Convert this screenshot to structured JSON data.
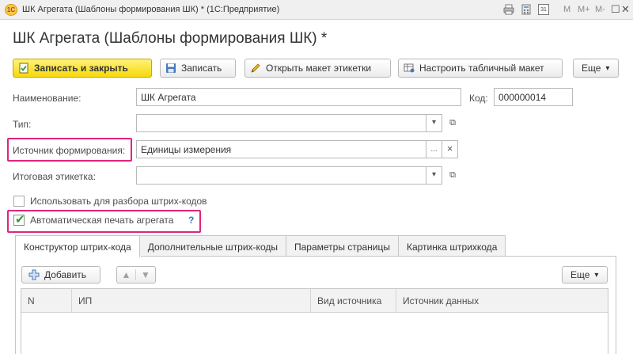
{
  "window": {
    "app_logo": "1С",
    "title": "ШК Агрегата (Шаблоны формирования ШК) * (1С:Предприятие)",
    "controls": {
      "memory_m": "M",
      "memory_m_plus": "M+",
      "memory_m_minus": "M-",
      "restore_glyph": "☐",
      "close_glyph": "✕",
      "calendar_day": "31"
    }
  },
  "page_title": "ШК Агрегата (Шаблоны формирования ШК) *",
  "toolbar": {
    "save_close_label": "Записать и закрыть",
    "save_label": "Записать",
    "open_layout_label": "Открыть макет этикетки",
    "configure_layout_label": "Настроить табличный макет",
    "more_label": "Еще",
    "more_arrow": "▾"
  },
  "form": {
    "name_label": "Наименование:",
    "name_value": "ШК Агрегата",
    "code_label": "Код:",
    "code_value": "000000014",
    "type_label": "Тип:",
    "type_value": "",
    "source_label": "Источник формирования:",
    "source_value": "Единицы измерения",
    "final_label_label": "Итоговая этикетка:",
    "final_label_value": "",
    "use_for_parsing_label": "Использовать для разбора штрих-кодов",
    "use_for_parsing_checked": false,
    "auto_print_label": "Автоматическая печать агрегата",
    "auto_print_checked": true,
    "help_glyph": "?",
    "dropdown_glyph": "▾",
    "open_glyph": "⧉",
    "select_glyph": "...",
    "clear_glyph": "×"
  },
  "tabs": [
    {
      "label": "Конструктор штрих-кода",
      "active": true
    },
    {
      "label": "Дополнительные штрих-коды",
      "active": false
    },
    {
      "label": "Параметры страницы",
      "active": false
    },
    {
      "label": "Картинка штрихкода",
      "active": false
    }
  ],
  "table_toolbar": {
    "add_label": "Добавить",
    "up_glyph": "🡅",
    "down_glyph": "🡇",
    "more_label": "Еще",
    "more_arrow": "▾"
  },
  "table": {
    "columns": [
      "N",
      "ИП",
      "Вид источника",
      "Источник данных"
    ],
    "rows": []
  },
  "colors": {
    "highlight": "#e0257c",
    "primary_button": "#f6d80c",
    "checkmark": "#2e9a2e"
  }
}
